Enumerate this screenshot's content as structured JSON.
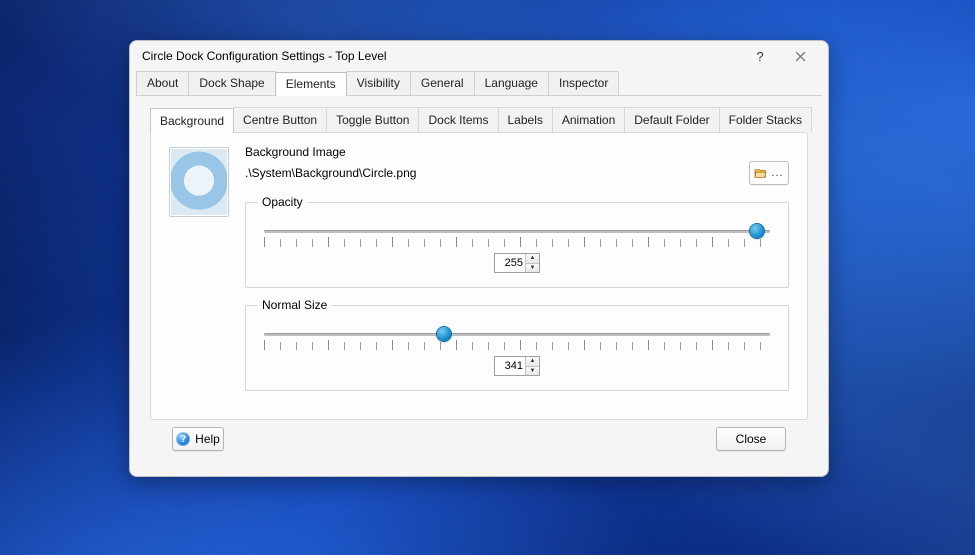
{
  "window": {
    "title": "Circle Dock Configuration Settings - Top Level"
  },
  "topTabs": {
    "items": [
      "About",
      "Dock Shape",
      "Elements",
      "Visibility",
      "General",
      "Language",
      "Inspector"
    ],
    "activeIndex": 2
  },
  "subTabs": {
    "items": [
      "Background",
      "Centre Button",
      "Toggle Button",
      "Dock Items",
      "Labels",
      "Animation",
      "Default Folder",
      "Folder Stacks"
    ],
    "activeIndex": 0
  },
  "backgroundImage": {
    "label": "Background Image",
    "path": ".\\System\\Background\\Circle.png"
  },
  "opacity": {
    "legend": "Opacity",
    "value": "255",
    "min": 0,
    "max": 255,
    "thumbPercent": 97.5
  },
  "normalSize": {
    "legend": "Normal Size",
    "value": "341",
    "min": 0,
    "max": 1000,
    "thumbPercent": 35.5
  },
  "footer": {
    "help": "Help",
    "close": "Close"
  }
}
